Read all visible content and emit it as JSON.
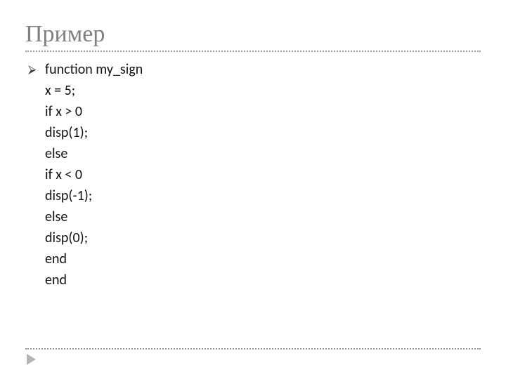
{
  "title": "Пример",
  "bullet_glyph": "⮚",
  "code": {
    "lines": [
      "function my_sign",
      "x = 5;",
      "if x > 0",
      "disp(1);",
      "else",
      "if x < 0",
      "disp(-1);",
      "else",
      "disp(0);",
      "end",
      "end"
    ]
  }
}
